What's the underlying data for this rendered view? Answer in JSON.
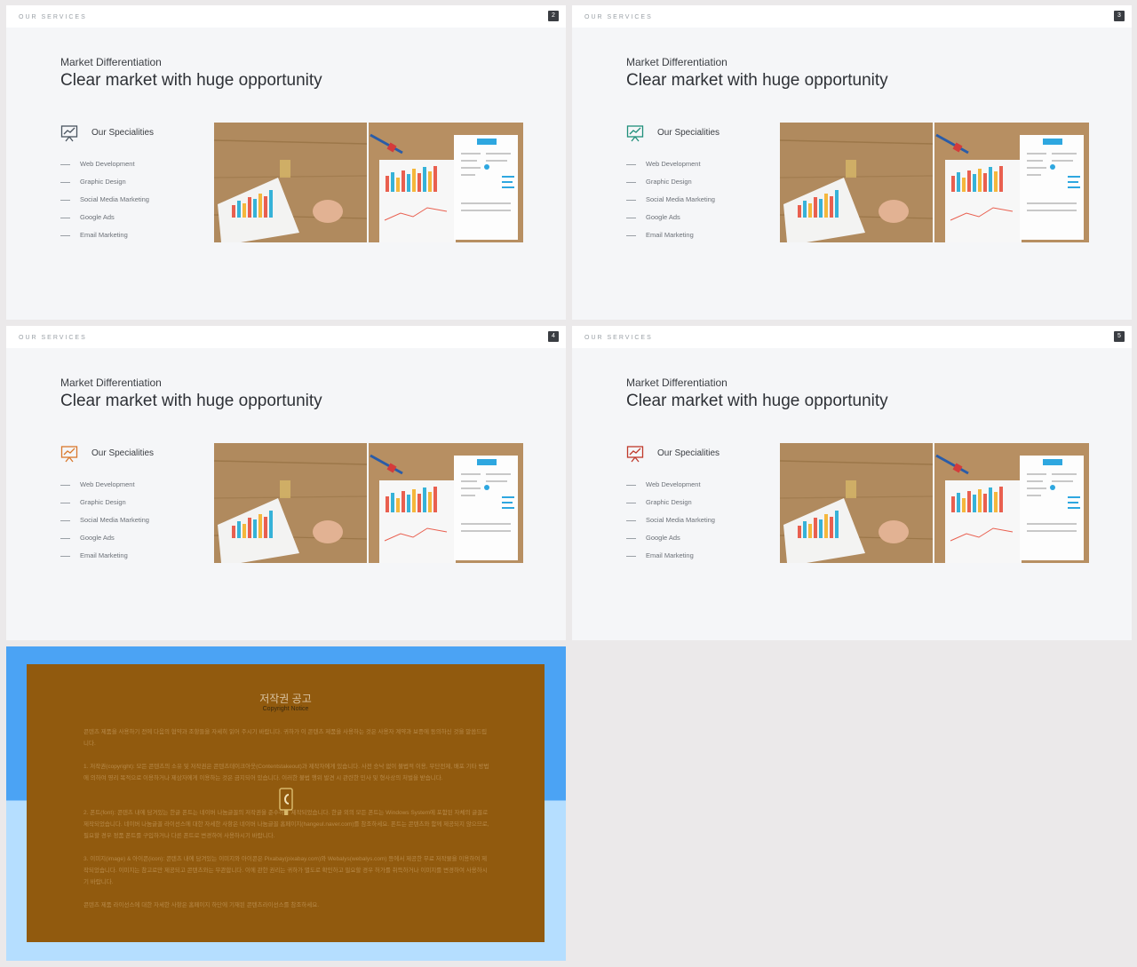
{
  "slides": [
    {
      "header_label": "OUR SERVICES",
      "number": "2",
      "subtitle": "Market Differentiation",
      "title": "Clear market with huge opportunity",
      "specialities_label": "Our Specialities",
      "icon_color": "#4a5560",
      "items": [
        "Web Development",
        "Graphic Design",
        "Social Media Marketing",
        "Google Ads",
        "Email Marketing"
      ]
    },
    {
      "header_label": "OUR SERVICES",
      "number": "3",
      "subtitle": "Market Differentiation",
      "title": "Clear market with huge opportunity",
      "specialities_label": "Our Specialities",
      "icon_color": "#1f8f7a",
      "items": [
        "Web Development",
        "Graphic Design",
        "Social Media Marketing",
        "Google Ads",
        "Email Marketing"
      ]
    },
    {
      "header_label": "OUR SERVICES",
      "number": "4",
      "subtitle": "Market Differentiation",
      "title": "Clear market with huge opportunity",
      "specialities_label": "Our Specialities",
      "icon_color": "#d9782c",
      "items": [
        "Web Development",
        "Graphic Design",
        "Social Media Marketing",
        "Google Ads",
        "Email Marketing"
      ]
    },
    {
      "header_label": "OUR SERVICES",
      "number": "5",
      "subtitle": "Market Differentiation",
      "title": "Clear market with huge opportunity",
      "specialities_label": "Our Specialities",
      "icon_color": "#c0392b",
      "items": [
        "Web Development",
        "Graphic Design",
        "Social Media Marketing",
        "Google Ads",
        "Email Marketing"
      ]
    }
  ],
  "notice": {
    "title": "저작권 공고",
    "subtitle": "Copyright Notice",
    "paragraphs": [
      "콘텐츠 제품을 사용하기 전에 다음의 협약과 조항들을 자세히 읽어 주시기 바랍니다. 귀하가 이 콘텐츠 제품을 사용하는 것은 사용자 계약과 보증에 동의하신 것을 말씀드립니다.",
      "1. 저작권(copyright): 모든 콘텐츠의 소유 및 저작권은 콘텐츠테이크아웃(Contentstakeout)과 제작자에게 있습니다. 사전 승낙 없이 불법적 이용, 무단전제, 배포 기타 방법에 의하여 영리 목적으로 이용하거나 제삼자에게 이용하는 것은 금지되어 있습니다. 이러한 불법 행위 발견 시 관련한 민사 및 형사상의 처벌을 받습니다.",
      "2. 폰트(font): 콘텐츠 내에 담겨있는 한글 폰트는 네이버 나눔글꼴의 저작권을 준수하여 제작되었습니다. 한글 외의 모든 폰트는 Windows System에 포함된 자체의 글꼴로 제작되었습니다. 네이버 나눔글꼴 라이선스에 대한 자세한 사항은 네이버 나눔글꼴 홈페이지(hangeul.naver.com)를 참조하세요. 폰트는 콘텐츠와 함께 제공되지 않으므로, 필요할 경우 정품 폰트를 구입하거나 다른 폰트로 변경하여 사용하시기 바랍니다.",
      "3. 이미지(image) & 아이콘(icon): 콘텐츠 내에 담겨있는 이미지와 아이콘은 Pixabay(pixabay.com)와 Webalys(webalys.com) 등에서 제공한 무료 저작물을 이용하여 제작되었습니다. 이미지는 참고로만 제공되고 콘텐츠와는 무관합니다. 이에 관한 권리는 귀하가 별도로 확인하고 필요할 경우 허가를 취득하거나 이미지를 변경하여 사용하시기 바랍니다.",
      "콘텐츠 제품 라이선스에 대한 자세한 사항은 홈페이지 하단에 기재된 콘텐츠라이선스를 참조하세요."
    ]
  }
}
